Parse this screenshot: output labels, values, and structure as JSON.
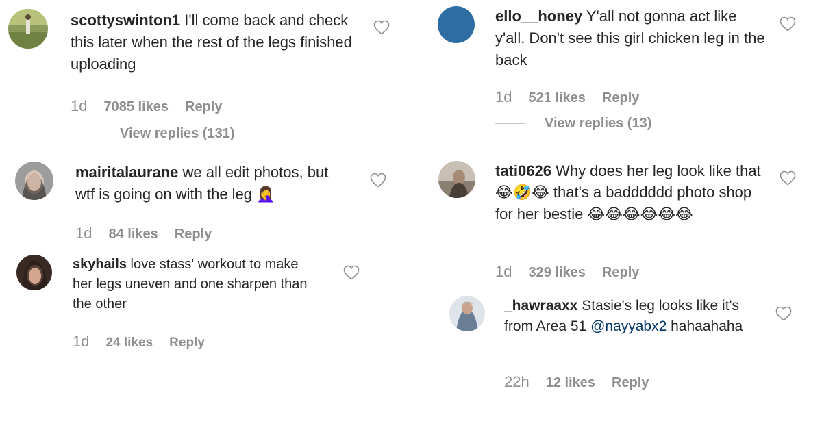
{
  "comments": [
    {
      "username": "scottyswinton1",
      "text": " I'll come back and check this later when the rest of the legs finished uploading",
      "time": "1d",
      "likes": "7085 likes",
      "reply": "Reply",
      "view_replies": "View replies (131)"
    },
    {
      "username": "mairitalaurane",
      "text": " we all edit photos, but wtf is going on with the leg ",
      "emoji": "🤦‍♀️",
      "time": "1d",
      "likes": "84 likes",
      "reply": "Reply"
    },
    {
      "username": "skyhails",
      "text": " love stass' workout to make her legs uneven and one sharpen than the other",
      "time": "1d",
      "likes": "24 likes",
      "reply": "Reply"
    },
    {
      "username": "ello__honey",
      "text": " Y'all not gonna act like y'all. Don't see this girl chicken leg in the back",
      "time": "1d",
      "likes": "521 likes",
      "reply": "Reply",
      "view_replies": "View replies (13)"
    },
    {
      "username": "tati0626",
      "text_a": " Why does her leg look like that ",
      "emoji_a": "😂🤣😂",
      "text_b": " that's a badddddd photo shop for her bestie ",
      "emoji_b": "😂😂😂😂😂😂",
      "time": "1d",
      "likes": "329 likes",
      "reply": "Reply"
    },
    {
      "username": "_hawraaxx",
      "text": " Stasie's leg looks like it's from Area 51 ",
      "mention": "@nayyabx2",
      "text_end": " hahaahaha",
      "time": "22h",
      "likes": "12 likes",
      "reply": "Reply"
    }
  ],
  "icons": {
    "like": "heart-outline-icon"
  },
  "colors": {
    "text": "#262626",
    "muted": "#8e8e8e",
    "mention": "#00376b",
    "avatar_blue": "#2e6da4"
  }
}
